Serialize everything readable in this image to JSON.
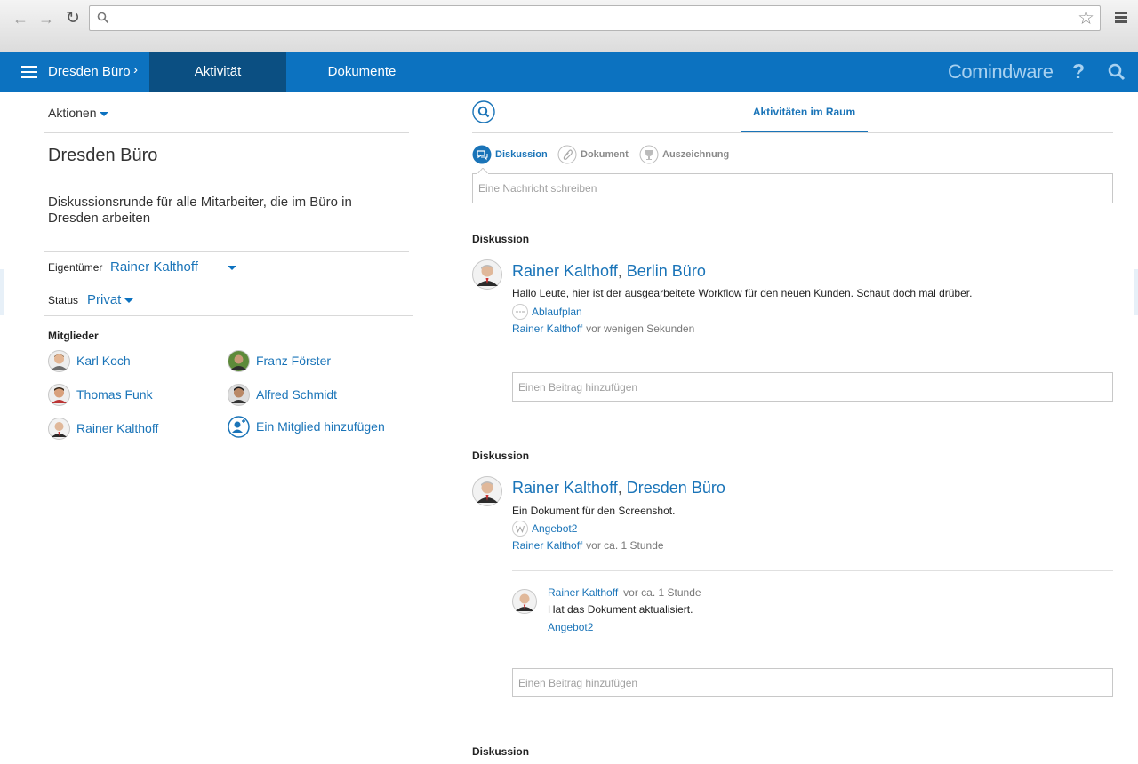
{
  "browser": {
    "address_value": "",
    "icons": [
      "back-arrow-icon",
      "forward-arrow-icon",
      "reload-icon",
      "search-icon",
      "star-icon",
      "menu-icon"
    ]
  },
  "header": {
    "space_title": "Dresden Büro",
    "tabs": [
      {
        "label": "Aktivität",
        "active": true
      },
      {
        "label": "Dokumente",
        "active": false
      }
    ],
    "brand": "Comindware",
    "help": "?"
  },
  "left": {
    "actions_label": "Aktionen",
    "space_name": "Dresden Büro",
    "description": "Diskussionsrunde für alle Mitarbeiter, die im Büro in Dresden arbeiten",
    "owner_label": "Eigentümer",
    "owner_value": "Rainer Kalthoff",
    "status_label": "Status",
    "status_value": "Privat",
    "members_label": "Mitglieder",
    "members": [
      {
        "name": "Karl Koch"
      },
      {
        "name": "Franz Förster"
      },
      {
        "name": "Thomas Funk"
      },
      {
        "name": "Alfred Schmidt"
      },
      {
        "name": "Rainer Kalthoff"
      }
    ],
    "add_member_label": "Ein Mitglied hinzufügen"
  },
  "right": {
    "tab_label": "Aktivitäten im Raum",
    "post_types": [
      {
        "label": "Diskussion",
        "active": true
      },
      {
        "label": "Dokument",
        "active": false
      },
      {
        "label": "Auszeichnung",
        "active": false
      }
    ],
    "message_placeholder": "Eine Nachricht schreiben",
    "comment_placeholder": "Einen Beitrag hinzufügen",
    "posts": [
      {
        "type_label": "Diskussion",
        "author": "Rainer Kalthoff",
        "separator": ",",
        "space": "Berlin Büro",
        "body": "Hallo Leute, hier ist der ausgearbeitete Workflow für den neuen Kunden. Schaut doch mal drüber.",
        "attachment": "Ablaufplan",
        "meta_author": "Rainer Kalthoff",
        "meta_time": "vor wenigen Sekunden"
      },
      {
        "type_label": "Diskussion",
        "author": "Rainer Kalthoff",
        "separator": ",",
        "space": "Dresden Büro",
        "body": "Ein Dokument für den Screenshot.",
        "attachment": "Angebot2",
        "meta_author": "Rainer Kalthoff",
        "meta_time": "vor ca. 1 Stunde",
        "reply": {
          "author": "Rainer Kalthoff",
          "time": "vor ca. 1 Stunde",
          "text": "Hat das Dokument aktualisiert.",
          "link": "Angebot2"
        }
      },
      {
        "type_label": "Diskussion"
      }
    ]
  },
  "colors": {
    "brand_blue": "#0c72c0",
    "active_tab": "#0b4f82",
    "link": "#1a74b8"
  }
}
